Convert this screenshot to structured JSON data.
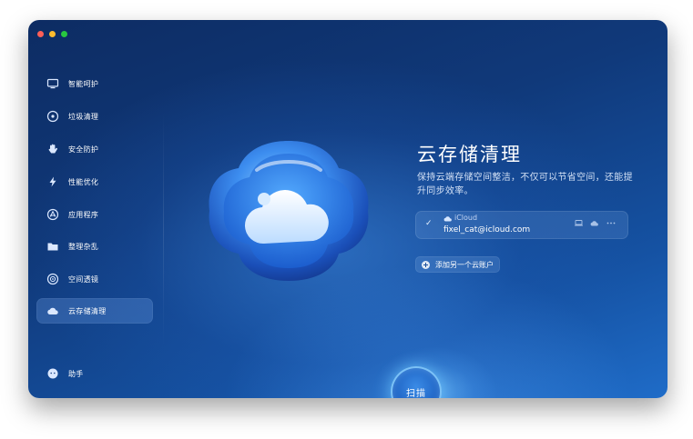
{
  "sidebar": {
    "items": [
      {
        "label": "智能呵护",
        "icon": "monitor-icon"
      },
      {
        "label": "垃圾清理",
        "icon": "disk-icon"
      },
      {
        "label": "安全防护",
        "icon": "hand-icon"
      },
      {
        "label": "性能优化",
        "icon": "lightning-icon"
      },
      {
        "label": "应用程序",
        "icon": "app-store-icon"
      },
      {
        "label": "整理杂乱",
        "icon": "folder-icon"
      },
      {
        "label": "空间透镜",
        "icon": "lens-icon"
      },
      {
        "label": "云存储清理",
        "icon": "cloud-icon",
        "active": true
      }
    ],
    "assistant": {
      "label": "助手",
      "icon": "assistant-icon"
    }
  },
  "main": {
    "title": "云存储清理",
    "description": "保持云端存储空间整洁，不仅可以节省空间，还能提升同步效率。",
    "account": {
      "provider": "iCloud",
      "email": "fixel_cat@icloud.com",
      "actions": [
        "laptop-icon",
        "cloud-icon",
        "more-icon"
      ]
    },
    "add_account_label": "添加另一个云账户",
    "scan_label": "扫描"
  },
  "colors": {
    "accent": "#2f7de0",
    "background_dark": "#0d2c63",
    "background_light": "#1f6cc8"
  }
}
